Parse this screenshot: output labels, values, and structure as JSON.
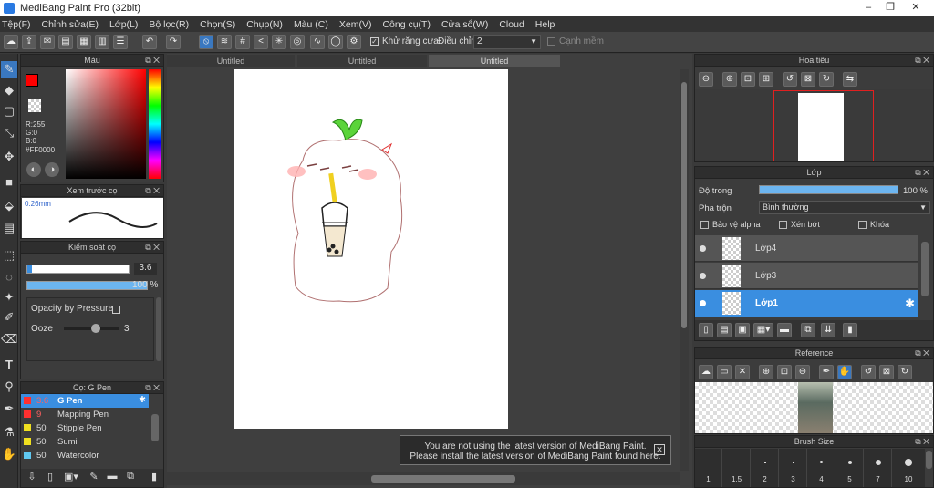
{
  "app": {
    "title": "MediBang Paint Pro (32bit)"
  },
  "menu": [
    "Tệp(F)",
    "Chỉnh sửa(E)",
    "Lớp(L)",
    "Bộ lọc(R)",
    "Chọn(S)",
    "Chụp(N)",
    "Màu (C)",
    "Xem(V)",
    "Công cụ(T)",
    "Cửa sổ(W)",
    "Cloud",
    "Help"
  ],
  "toolbar": {
    "antialias_label": "Khử răng cưa",
    "adjust_label": "Điều chỉnh",
    "adjust_value": "2",
    "edge_label": "Cạnh mềm"
  },
  "color_panel": {
    "title": "Màu",
    "r": "R:255",
    "g": "G:0",
    "b": "B:0",
    "hex": "#FF0000",
    "accent": "#ff0000"
  },
  "brush_preview": {
    "title": "Xem trước cọ",
    "size": "0.26mm"
  },
  "brush_control": {
    "title": "Kiểm soát cọ",
    "size_value": "3.6",
    "opacity_value": "100 %",
    "pressure_label": "Opacity by Pressure",
    "ooze_label": "Ooze",
    "ooze_value": "3"
  },
  "brush_list": {
    "title": "Cọ: G Pen",
    "items": [
      {
        "size": "3.6",
        "name": "G Pen",
        "color": "#ff3030"
      },
      {
        "size": "9",
        "name": "Mapping Pen",
        "color": "#ff3030"
      },
      {
        "size": "50",
        "name": "Stipple Pen",
        "color": "#f0e020"
      },
      {
        "size": "50",
        "name": "Sumi",
        "color": "#f0e020"
      },
      {
        "size": "50",
        "name": "Watercolor",
        "color": "#60c8f0"
      }
    ]
  },
  "tabs": [
    "Untitled",
    "Untitled",
    "Untitled"
  ],
  "notice": {
    "line1": "You are not using the latest version of MediBang Paint.",
    "line2": "Please install the latest version of MediBang Paint found here."
  },
  "navigator": {
    "title": "Hoa tiêu"
  },
  "layers": {
    "title": "Lớp",
    "opacity_label": "Độ trong",
    "opacity_value": "100 %",
    "blend_label": "Pha trộn",
    "blend_value": "Bình thường",
    "alpha_label": "Bảo vệ alpha",
    "clip_label": "Xén bớt",
    "lock_label": "Khóa",
    "items": [
      "Lớp4",
      "Lớp3",
      "Lớp1"
    ]
  },
  "reference": {
    "title": "Reference"
  },
  "brush_size": {
    "title": "Brush Size",
    "sizes": [
      "1",
      "1.5",
      "2",
      "3",
      "4",
      "5",
      "7",
      "10"
    ]
  }
}
